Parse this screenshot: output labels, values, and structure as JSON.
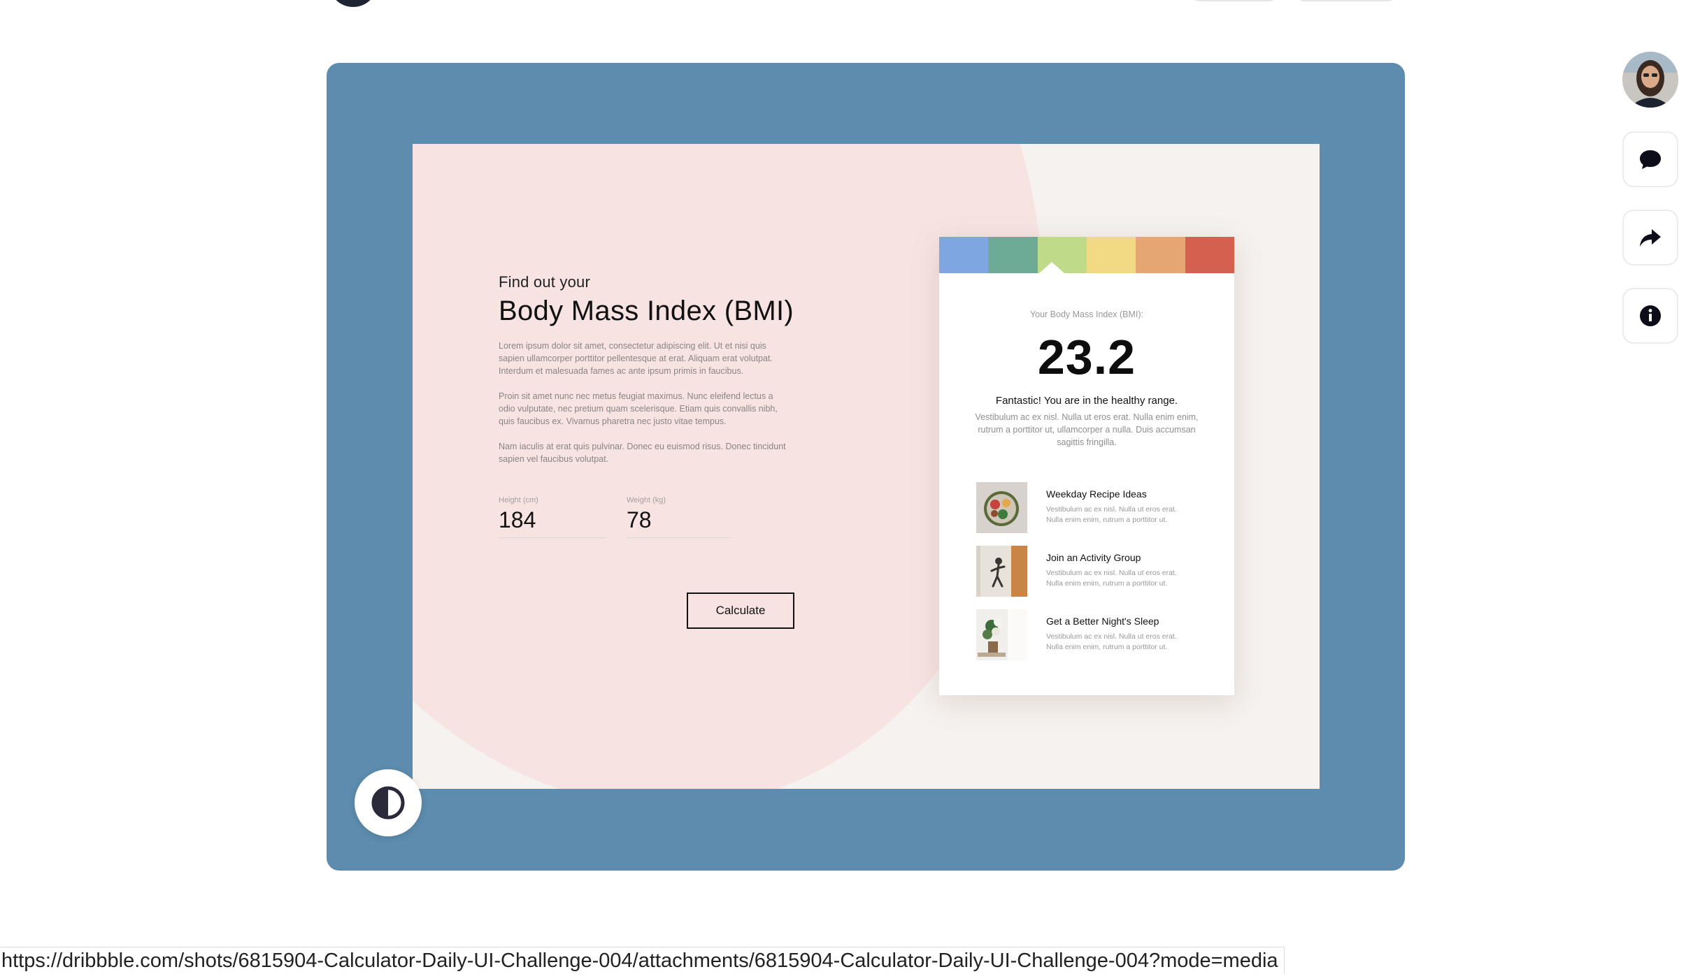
{
  "shot": {
    "eyebrow": "Find out your",
    "title": "Body Mass Index (BMI)",
    "paragraphs": [
      "Lorem ipsum dolor sit amet, consectetur adipiscing elit. Ut et nisi quis sapien ullamcorper porttitor pellentesque at erat. Aliquam erat volutpat. Interdum et malesuada fames ac ante ipsum primis in faucibus.",
      "Proin sit amet nunc nec metus feugiat maximus. Nunc eleifend lectus a odio vulputate, nec pretium quam scelerisque. Etiam quis convallis nibh, quis faucibus ex. Vivamus pharetra nec justo vitae tempus.",
      "Nam iaculis at erat quis pulvinar. Donec eu euismod risus. Donec tincidunt sapien vel faucibus volutpat."
    ],
    "height": {
      "label": "Height (cm)",
      "value": "184"
    },
    "weight": {
      "label": "Weight (kg)",
      "value": "78"
    },
    "calculate_label": "Calculate",
    "result": {
      "label": "Your Body Mass Index (BMI):",
      "value": "23.2",
      "message": "Fantastic! You are in the healthy range.",
      "description": "Vestibulum ac ex nisl. Nulla ut eros erat. Nulla enim enim, rutrum a porttitor ut, ullamcorper a nulla. Duis accumsan sagittis fringilla.",
      "scale_colors": [
        "#7ea6e0",
        "#6eab96",
        "#bfdb8a",
        "#f2da85",
        "#e6a673",
        "#d6604f"
      ],
      "recommendations": [
        {
          "title": "Weekday Recipe Ideas",
          "body": "Vestibulum ac ex nisl. Nulla ut eros erat. Nulla enim enim, rutrum a porttitor ut."
        },
        {
          "title": "Join an Activity Group",
          "body": "Vestibulum ac ex nisl. Nulla ut eros erat. Nulla enim enim, rutrum a porttitor ut."
        },
        {
          "title": "Get a Better Night's Sleep",
          "body": "Vestibulum ac ex nisl. Nulla ut eros erat. Nulla enim enim, rutrum a porttitor ut."
        }
      ]
    }
  },
  "colors": {
    "frame": "#5d8cae",
    "shot_bg": "#f6f2ef",
    "blob": "#f7e4e2"
  },
  "rail": {
    "icons": [
      "avatar",
      "comment-icon",
      "share-icon",
      "info-icon"
    ]
  },
  "status_url": "https://dribbble.com/shots/6815904-Calculator-Daily-UI-Challenge-004/attachments/6815904-Calculator-Daily-UI-Challenge-004?mode=media"
}
